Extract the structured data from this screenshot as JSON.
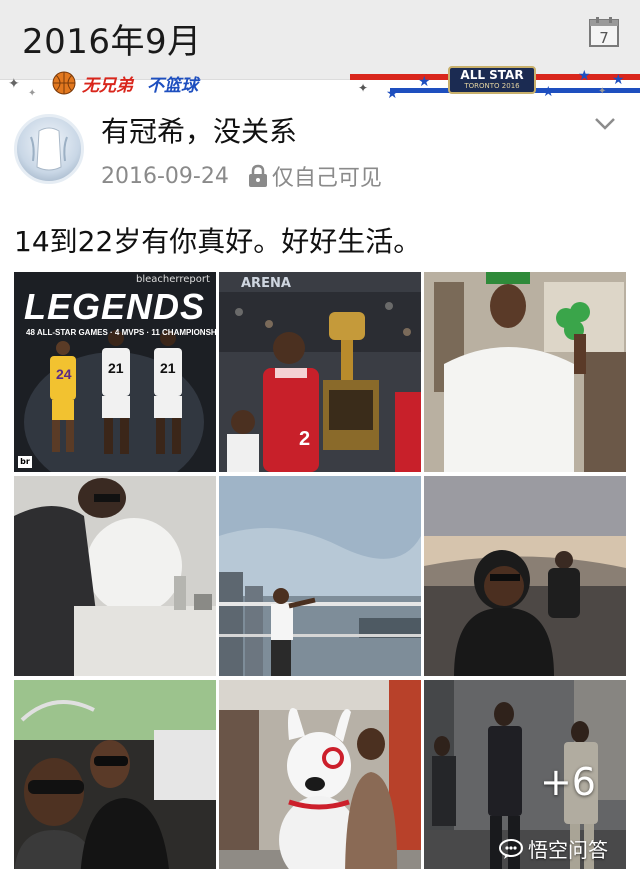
{
  "header": {
    "month": "2016年9月",
    "calendar_day": "7"
  },
  "banner": {
    "left_text_red": "无兄弟",
    "left_text_blue": "不篮球",
    "allstar_title": "ALL STAR",
    "allstar_sub": "TORONTO 2016"
  },
  "post": {
    "username": "有冠希，没关系",
    "date": "2016-09-24",
    "visibility": "仅自己可见",
    "text": "14到22岁有你真好。好好生活。",
    "more_count": "+6"
  },
  "photos": {
    "legends_title": "LEGENDS",
    "legends_subtitle": "48 ALL-STAR GAMES · 4 MVPS · 11 CHAMPIONSHIPS",
    "legends_brand": "bleacherreport",
    "legends_corner": "br",
    "jersey_numbers": [
      "24",
      "21",
      "21"
    ],
    "arena_label": "ARENA",
    "trophy_jersey": "2"
  },
  "watermark": {
    "text": "悟空问答"
  },
  "colors": {
    "header_bg": "#ececec",
    "stripe_red": "#d9261c",
    "stripe_blue": "#1e4fbf",
    "meta_gray": "#8a8a8a"
  }
}
